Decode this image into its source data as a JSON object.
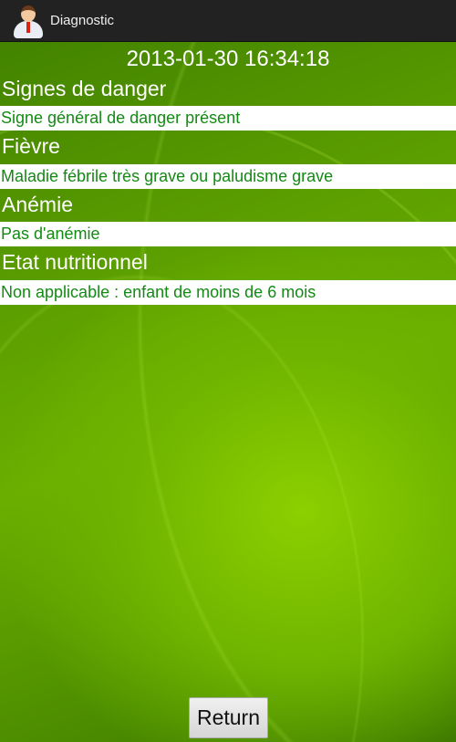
{
  "app": {
    "title": "Diagnostic",
    "icon": "doctor-avatar-icon"
  },
  "timestamp": "2013-01-30 16:34:18",
  "sections": [
    {
      "header": "Signes de danger",
      "value": "Signe général de danger présent"
    },
    {
      "header": "Fièvre",
      "value": "Maladie fébrile très grave ou paludisme grave"
    },
    {
      "header": "Anémie",
      "value": "Pas d'anémie"
    },
    {
      "header": "Etat nutritionnel",
      "value": "Non applicable : enfant de moins de 6 mois"
    }
  ],
  "return_label": "Return",
  "colors": {
    "action_bar": "#222222",
    "value_text": "#138a13",
    "background": "#6aae00"
  }
}
